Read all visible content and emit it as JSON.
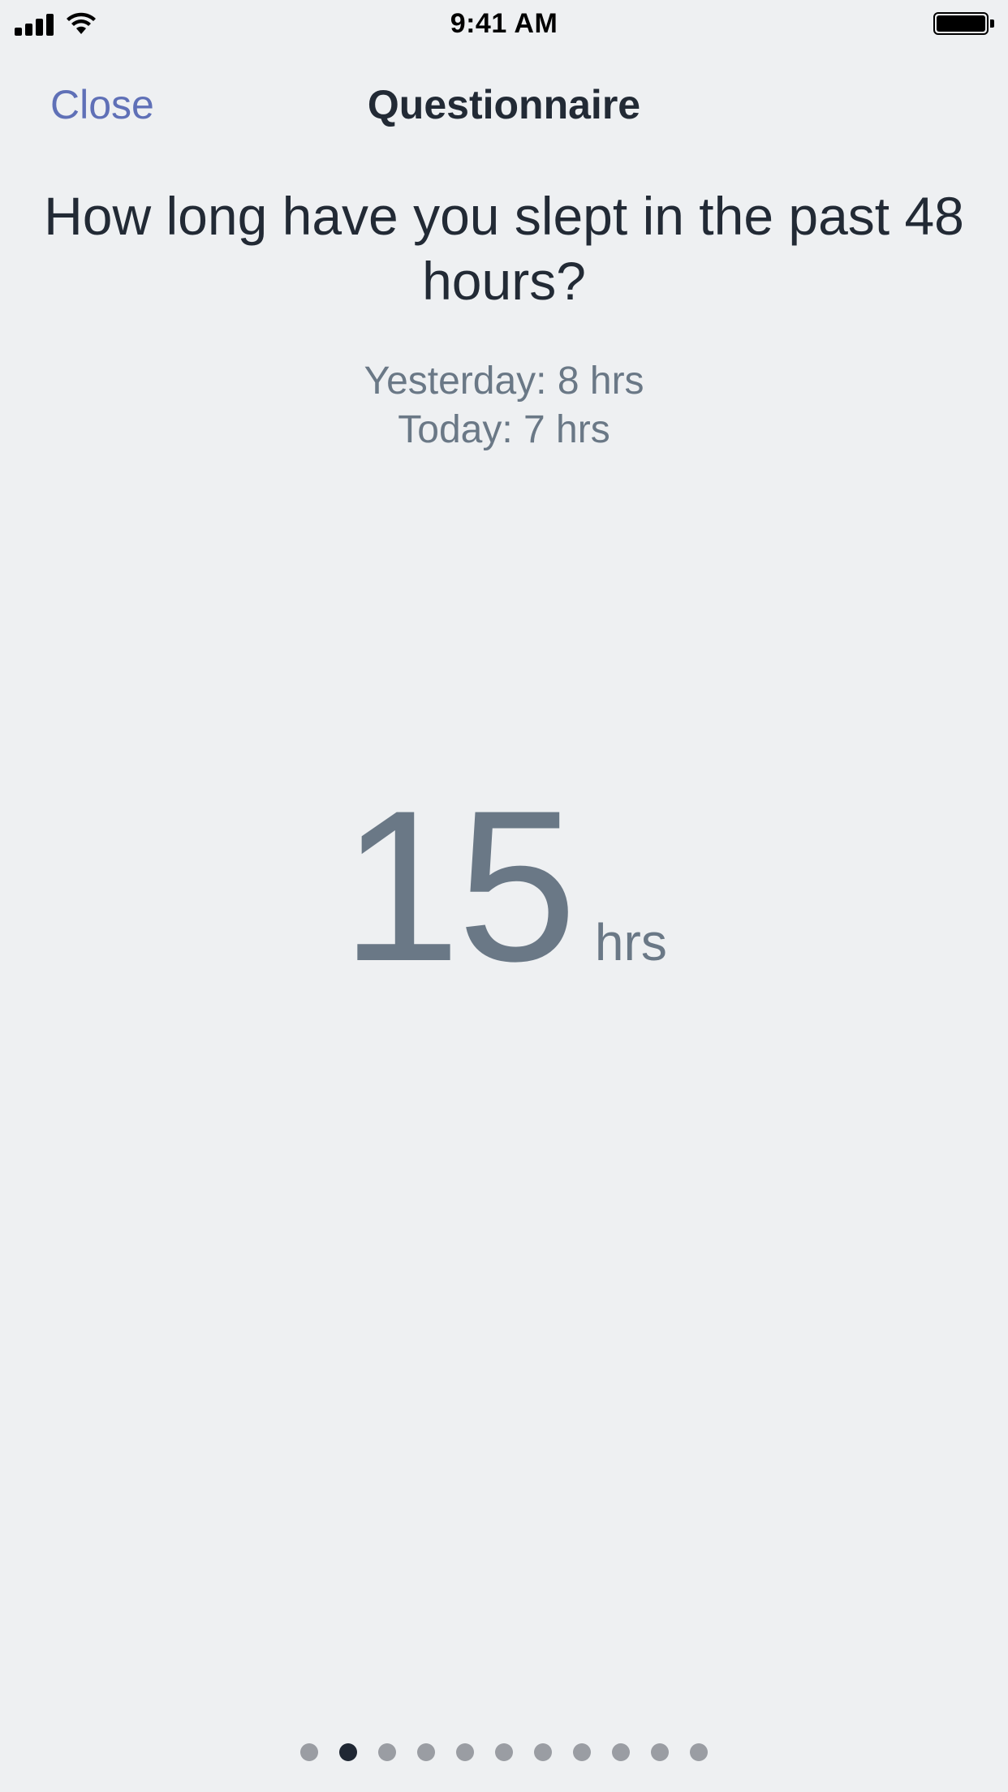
{
  "status_bar": {
    "time": "9:41 AM",
    "icons": [
      "signal-icon",
      "wifi-icon",
      "battery-icon"
    ]
  },
  "nav": {
    "close_label": "Close",
    "title": "Questionnaire"
  },
  "question": {
    "text": "How long have you slept in the past 48 hours?"
  },
  "history": {
    "yesterday": "Yesterday: 8 hrs",
    "today": "Today: 7 hrs"
  },
  "value": {
    "number": "15",
    "unit": "hrs"
  },
  "pager": {
    "total_pages": 11,
    "current_page": 2
  },
  "colors": {
    "background": "#eef0f2",
    "accent": "#5f70b7",
    "primary_text": "#222a35",
    "secondary_text": "#6a7886",
    "dot_inactive": "#9a9da3",
    "dot_active": "#1f2733"
  }
}
